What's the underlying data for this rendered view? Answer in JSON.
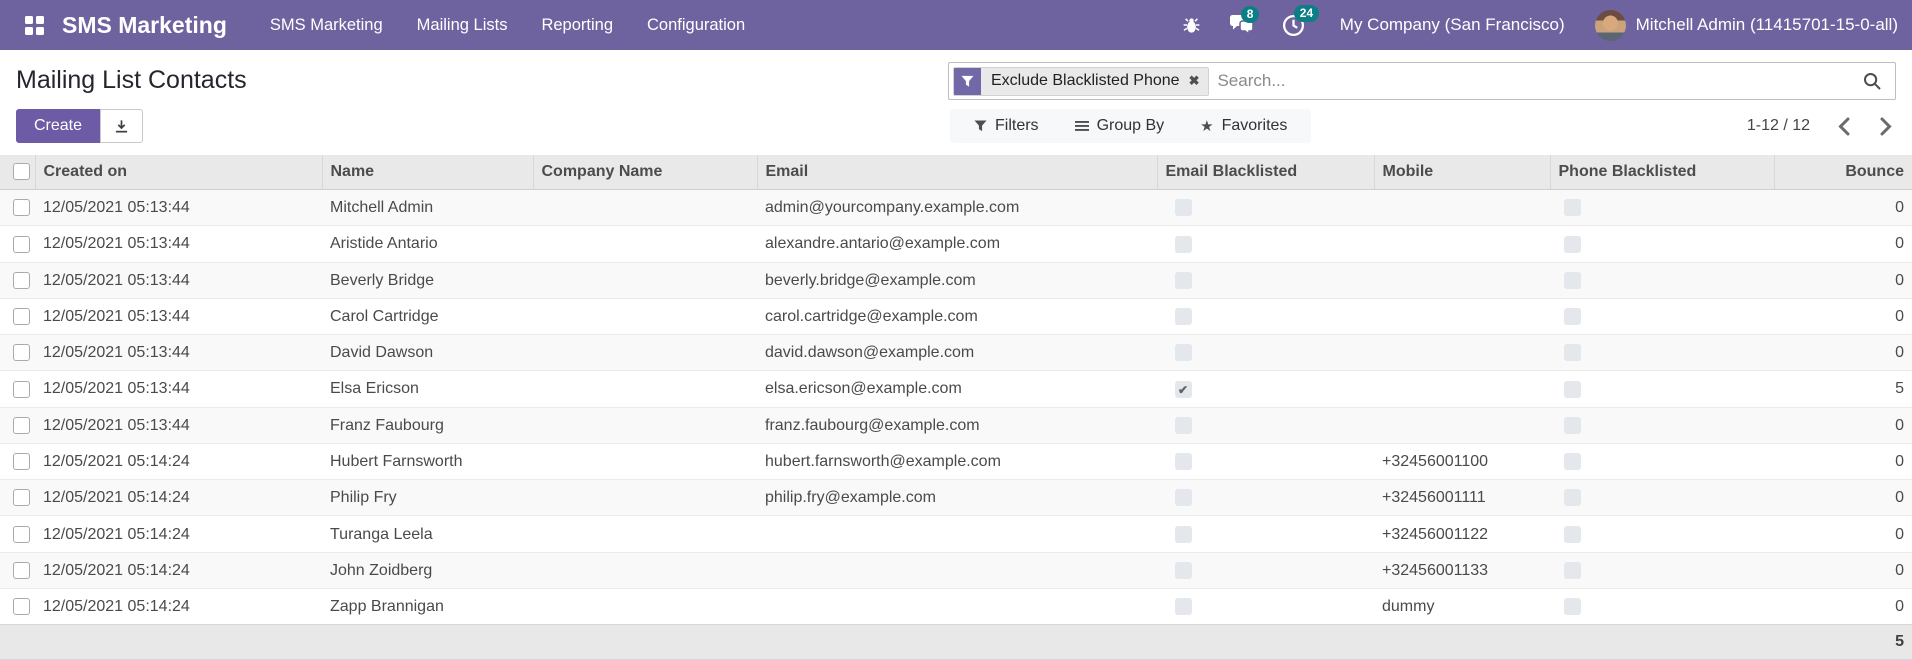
{
  "navbar": {
    "brand": "SMS Marketing",
    "menus": [
      {
        "label": "SMS Marketing"
      },
      {
        "label": "Mailing Lists"
      },
      {
        "label": "Reporting"
      },
      {
        "label": "Configuration"
      }
    ],
    "systray": {
      "messages_badge": "8",
      "activities_badge": "24",
      "company": "My Company (San Francisco)",
      "user": "Mitchell Admin (11415701-15-0-all)"
    }
  },
  "control_panel": {
    "title": "Mailing List Contacts",
    "create_label": "Create",
    "search": {
      "facet_label": "Exclude Blacklisted Phone",
      "placeholder": "Search..."
    },
    "search_buttons": {
      "filters": "Filters",
      "group_by": "Group By",
      "favorites": "Favorites"
    },
    "pager": {
      "range": "1-12 / 12"
    }
  },
  "table": {
    "columns": [
      "Created on",
      "Name",
      "Company Name",
      "Email",
      "Email Blacklisted",
      "Mobile",
      "Phone Blacklisted",
      "Bounce"
    ],
    "rows": [
      {
        "created_on": "12/05/2021 05:13:44",
        "name": "Mitchell Admin",
        "company": "",
        "email": "admin@yourcompany.example.com",
        "email_blacklisted": false,
        "mobile": "",
        "phone_blacklisted": false,
        "bounce": "0"
      },
      {
        "created_on": "12/05/2021 05:13:44",
        "name": "Aristide Antario",
        "company": "",
        "email": "alexandre.antario@example.com",
        "email_blacklisted": false,
        "mobile": "",
        "phone_blacklisted": false,
        "bounce": "0"
      },
      {
        "created_on": "12/05/2021 05:13:44",
        "name": "Beverly Bridge",
        "company": "",
        "email": "beverly.bridge@example.com",
        "email_blacklisted": false,
        "mobile": "",
        "phone_blacklisted": false,
        "bounce": "0"
      },
      {
        "created_on": "12/05/2021 05:13:44",
        "name": "Carol Cartridge",
        "company": "",
        "email": "carol.cartridge@example.com",
        "email_blacklisted": false,
        "mobile": "",
        "phone_blacklisted": false,
        "bounce": "0"
      },
      {
        "created_on": "12/05/2021 05:13:44",
        "name": "David Dawson",
        "company": "",
        "email": "david.dawson@example.com",
        "email_blacklisted": false,
        "mobile": "",
        "phone_blacklisted": false,
        "bounce": "0"
      },
      {
        "created_on": "12/05/2021 05:13:44",
        "name": "Elsa Ericson",
        "company": "",
        "email": "elsa.ericson@example.com",
        "email_blacklisted": true,
        "mobile": "",
        "phone_blacklisted": false,
        "bounce": "5"
      },
      {
        "created_on": "12/05/2021 05:13:44",
        "name": "Franz Faubourg",
        "company": "",
        "email": "franz.faubourg@example.com",
        "email_blacklisted": false,
        "mobile": "",
        "phone_blacklisted": false,
        "bounce": "0"
      },
      {
        "created_on": "12/05/2021 05:14:24",
        "name": "Hubert Farnsworth",
        "company": "",
        "email": "hubert.farnsworth@example.com",
        "email_blacklisted": false,
        "mobile": "+32456001100",
        "phone_blacklisted": false,
        "bounce": "0"
      },
      {
        "created_on": "12/05/2021 05:14:24",
        "name": "Philip Fry",
        "company": "",
        "email": "philip.fry@example.com",
        "email_blacklisted": false,
        "mobile": "+32456001111",
        "phone_blacklisted": false,
        "bounce": "0"
      },
      {
        "created_on": "12/05/2021 05:14:24",
        "name": "Turanga Leela",
        "company": "",
        "email": "",
        "email_blacklisted": false,
        "mobile": "+32456001122",
        "phone_blacklisted": false,
        "bounce": "0"
      },
      {
        "created_on": "12/05/2021 05:14:24",
        "name": "John Zoidberg",
        "company": "",
        "email": "",
        "email_blacklisted": false,
        "mobile": "+32456001133",
        "phone_blacklisted": false,
        "bounce": "0"
      },
      {
        "created_on": "12/05/2021 05:14:24",
        "name": "Zapp Brannigan",
        "company": "",
        "email": "",
        "email_blacklisted": false,
        "mobile": "dummy",
        "phone_blacklisted": false,
        "bounce": "0"
      }
    ],
    "footer": {
      "bounce_total": "5"
    }
  },
  "colors": {
    "navbar_bg": "#6e639e",
    "primary_button": "#6d5ba6",
    "badge": "#0c7f86",
    "facet_icon_bg": "#7168a8"
  }
}
